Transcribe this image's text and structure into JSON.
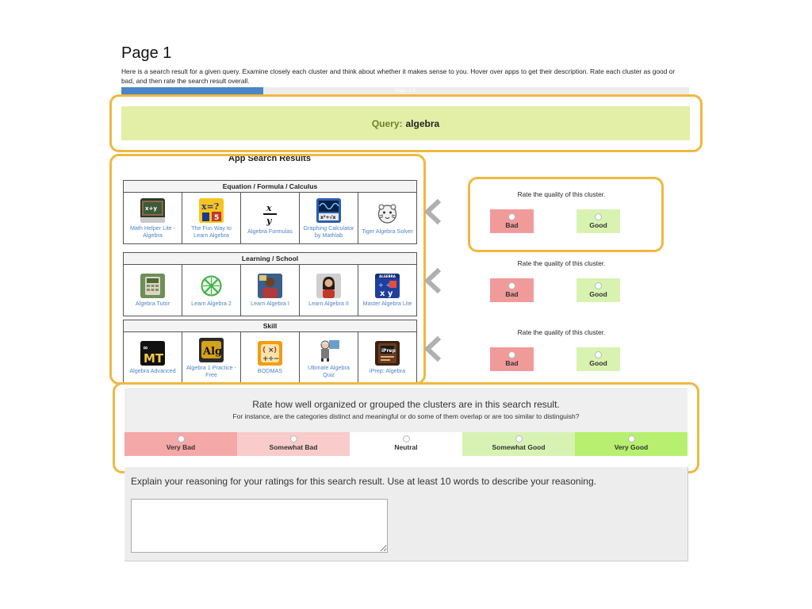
{
  "page": {
    "title": "Page 1",
    "instructions": "Here is a search result for a given query. Examine closely each cluster and think about whether it makes sense to you. Hover over apps to get their description. Rate each cluster as good or bad, and then rate the search result overall.",
    "progress_label": "Page 1/4",
    "progress_fraction": 0.25
  },
  "query": {
    "label": "Query:",
    "value": "algebra"
  },
  "results": {
    "title": "App Search Results",
    "clusters": [
      {
        "name": "Equation / Formula / Calculus",
        "apps": [
          {
            "name": "Math Helper Lite - Algebra",
            "icon": "chalkboard-icon"
          },
          {
            "name": "The Fun Way to Learn Algebra",
            "icon": "x-equals-icon"
          },
          {
            "name": "Algebra Formulas",
            "icon": "fraction-icon"
          },
          {
            "name": "Graphing Calculator by Mathlab",
            "icon": "graph-wave-icon"
          },
          {
            "name": "Tiger Algebra Solver",
            "icon": "tiger-icon"
          }
        ]
      },
      {
        "name": "Learning / School",
        "apps": [
          {
            "name": "Algebra Tutor",
            "icon": "calculator-icon"
          },
          {
            "name": "Learn Algebra 2",
            "icon": "graph-circle-icon"
          },
          {
            "name": "Learn Algebra I",
            "icon": "student-photo-icon"
          },
          {
            "name": "Learn Algebra II",
            "icon": "teacher-photo-icon"
          },
          {
            "name": "Master Algebra Lite",
            "icon": "xy-grid-icon"
          }
        ]
      },
      {
        "name": "Skill",
        "apps": [
          {
            "name": "Algebra Advanced",
            "icon": "mt-logo-icon"
          },
          {
            "name": "Algebra 1 Practice - Free",
            "icon": "alg-badge-icon"
          },
          {
            "name": "BODMAS",
            "icon": "operators-icon"
          },
          {
            "name": "Ultimate Algebra Quiz",
            "icon": "professor-icon"
          },
          {
            "name": "iPrep: Algebra",
            "icon": "book-icon"
          }
        ]
      }
    ]
  },
  "cluster_rating": {
    "caption": "Rate the quality of this cluster.",
    "bad_label": "Bad",
    "good_label": "Good"
  },
  "overall": {
    "title": "Rate how well organized or grouped the clusters are in this search result.",
    "subtitle": "For instance, are the categories distinct and meaningful or do some of them overlap or are too similar to distinguish?",
    "options": [
      {
        "label": "Very Bad",
        "color": "#f4a8a8"
      },
      {
        "label": "Somewhat Bad",
        "color": "#f9cbcb"
      },
      {
        "label": "Neutral",
        "color": "#ffffff"
      },
      {
        "label": "Somewhat Good",
        "color": "#d8f2b3"
      },
      {
        "label": "Very Good",
        "color": "#b7f06f"
      }
    ]
  },
  "reasoning": {
    "label": "Explain your reasoning for your ratings for this search result. Use at least 10 words to describe your reasoning.",
    "value": ""
  },
  "colors": {
    "highlight": "#f0b840",
    "query_band": "#e3efa6",
    "progress": "#4a86c8",
    "link": "#4f83c2"
  }
}
